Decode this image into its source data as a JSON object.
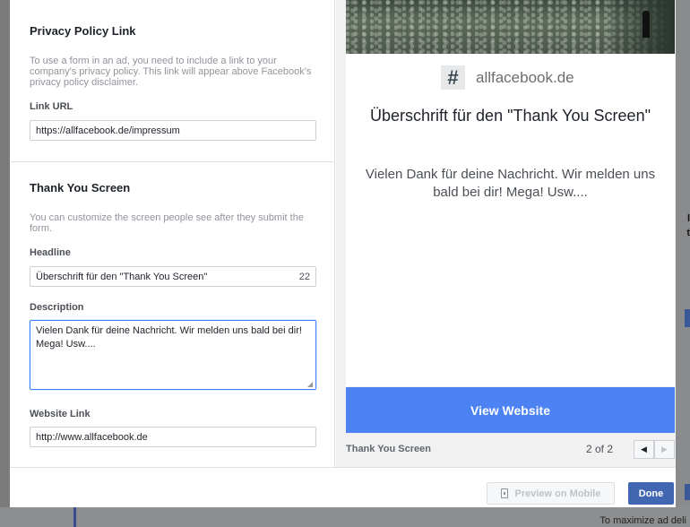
{
  "privacy": {
    "title": "Privacy Policy Link",
    "hint": "To use a form in an ad, you need to include a link to your company's privacy policy. This link will appear above Facebook's privacy policy disclaimer.",
    "link_label": "Link URL",
    "link_value": "https://allfacebook.de/impressum"
  },
  "thank_you": {
    "title": "Thank You Screen",
    "hint": "You can customize the screen people see after they submit the form.",
    "headline_label": "Headline",
    "headline_value": "Überschrift für den \"Thank You Screen\"",
    "headline_counter": "22",
    "description_label": "Description",
    "description_value": "Vielen Dank für deine Nachricht. Wir melden uns bald bei dir! Mega! Usw....",
    "website_label": "Website Link",
    "website_value": "http://www.allfacebook.de"
  },
  "preview": {
    "brand_logo": "#",
    "brand_name": "allfacebook.de",
    "headline": "Überschrift für den \"Thank You Screen\"",
    "description": "Vielen Dank für deine Nachricht. Wir melden uns bald bei dir! Mega! Usw....",
    "cta_label": "View Website",
    "screen_name": "Thank You Screen",
    "pager_text": "2 of 2",
    "prev_icon": "◀",
    "next_icon": "▶"
  },
  "footer": {
    "preview_mobile_label": "Preview on Mobile",
    "done_label": "Done"
  },
  "background": {
    "bottom_text": "To maximize ad deli"
  },
  "colors": {
    "cta": "#4d82f3",
    "done": "#4267b2",
    "focus_border": "#4080ff"
  }
}
